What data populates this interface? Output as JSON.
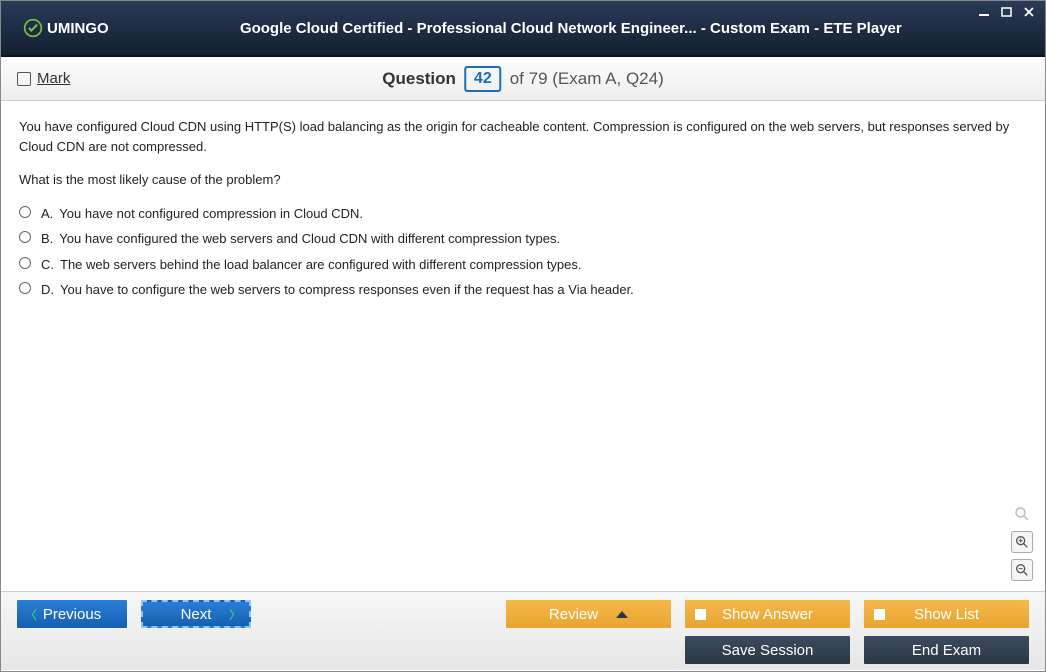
{
  "titlebar": {
    "brand": "UMINGO",
    "title": "Google Cloud Certified - Professional Cloud Network Engineer... - Custom Exam - ETE Player"
  },
  "header": {
    "mark_label": "Mark",
    "question_label": "Question",
    "current_num": "42",
    "of_total": "of 79 (Exam A, Q24)"
  },
  "question": {
    "body": "You have configured Cloud CDN using HTTP(S) load balancing as the origin for cacheable content. Compression is configured on the web servers, but responses served by Cloud CDN are not compressed.",
    "prompt": "What is the most likely cause of the problem?",
    "options": [
      {
        "letter": "A.",
        "text": "You have not configured compression in Cloud CDN."
      },
      {
        "letter": "B.",
        "text": "You have configured the web servers and Cloud CDN with different compression types."
      },
      {
        "letter": "C.",
        "text": "The web servers behind the load balancer are configured with different compression types."
      },
      {
        "letter": "D.",
        "text": "You have to configure the web servers to compress responses even if the request has a Via header."
      }
    ]
  },
  "footer": {
    "previous": "Previous",
    "next": "Next",
    "review": "Review",
    "show_answer": "Show Answer",
    "show_list": "Show List",
    "save_session": "Save Session",
    "end_exam": "End Exam"
  }
}
